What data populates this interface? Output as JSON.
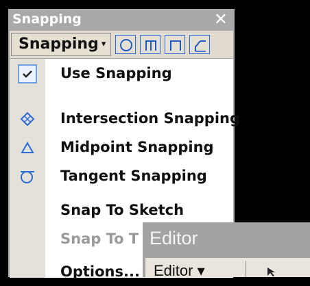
{
  "snapping_window": {
    "title": "Snapping",
    "close_glyph": "✕",
    "toolbar": {
      "dropdown_label": "Snapping",
      "dropdown_caret": "▾",
      "tools": [
        {
          "name": "circle-snap-icon"
        },
        {
          "name": "midpoint-snap-icon"
        },
        {
          "name": "square-snap-icon"
        },
        {
          "name": "curve-snap-icon"
        }
      ]
    },
    "menu": {
      "items": [
        {
          "label": "Use Snapping",
          "icon": "check-icon",
          "checked": true,
          "enabled": true
        },
        {
          "label": "Intersection Snapping",
          "icon": "intersection-icon",
          "enabled": true
        },
        {
          "label": "Midpoint Snapping",
          "icon": "midpoint-triangle-icon",
          "enabled": true
        },
        {
          "label": "Tangent Snapping",
          "icon": "tangent-icon",
          "enabled": true
        },
        {
          "label": "Snap To Sketch",
          "icon": null,
          "enabled": true
        },
        {
          "label": "Snap To T",
          "icon": null,
          "enabled": false
        },
        {
          "label": "Options...",
          "icon": null,
          "enabled": true
        }
      ]
    }
  },
  "editor_window": {
    "title": "Editor",
    "toolbar": {
      "dropdown_label": "Editor ▾"
    }
  },
  "colors": {
    "titlebar": "#a9a9a9",
    "menu_gutter": "#e4e1da",
    "icon_blue": "#2b6bd8",
    "disabled_text": "#9a9a9a"
  }
}
